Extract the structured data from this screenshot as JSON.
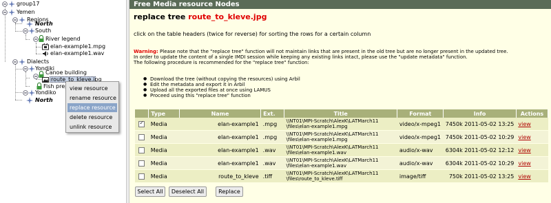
{
  "tree": {
    "root": "group17",
    "yemen": "Yemen",
    "regions": "Regions",
    "north": "North",
    "south": "South",
    "river_legend": "River legend",
    "elan_mpg": "elan-example1.mpg",
    "elan_wav": "elan-example1.wav",
    "dialects": "Dialects",
    "yondiki": "Yondiki",
    "canoe": "Canoe building",
    "route": "route_to_kleve.jpg",
    "fish": "Fish prep",
    "yondiko": "Yondiko",
    "north2": "North"
  },
  "context_menu": {
    "items": [
      "view resource",
      "rename resource",
      "replace resource",
      "delete resource",
      "unlink resource"
    ],
    "highlighted": "replace resource"
  },
  "panel": {
    "header": "Free Media resource Nodes",
    "title_prefix": "replace tree",
    "title_file": "route_to_kleve.jpg",
    "hint": "click on the table headers (twice for reverse) for sorting the rows for a certain column",
    "warning_label": "Warning:",
    "warning_text": " Please note that the \"replace tree\" function will not maintain links that are present in the old tree but are no longer present in the updated tree.",
    "warning_line2": "In order to update the content of a single IMDI session while keeping any existing links intact, please use the \"update metadata\" function.",
    "warning_line3": "The following procedure is recommended for the \"replace tree\" function:",
    "steps": [
      "Download the tree (without copying the resources) using Arbil",
      "Edit the metadata and export it in Arbil",
      "Upload all the exported files at once using LAMUS",
      "Proceed using this \"replace tree\" function"
    ]
  },
  "table": {
    "headers": [
      "",
      "Type",
      "Name",
      "Ext.",
      "Title",
      "Format",
      "Info",
      "Actions"
    ],
    "rows": [
      {
        "checked": true,
        "type": "Media",
        "name": "elan-example1",
        "ext": ".mpg",
        "title1": "\\\\NT01\\MPI-Scratch\\AlexK\\LATMarch11",
        "title2": "\\files\\elan-example1.mpg",
        "format": "video/x-mpeg1",
        "info": "7450k 2011-05-02 13:25",
        "action": "view"
      },
      {
        "checked": false,
        "type": "Media",
        "name": "elan-example1",
        "ext": ".mpg",
        "title1": "\\\\NT01\\MPI-Scratch\\AlexK\\LATMarch11",
        "title2": "\\files\\elan-example1.mpg",
        "format": "video/x-mpeg1",
        "info": "7450k 2011-05-02 10:29",
        "action": "view"
      },
      {
        "checked": false,
        "type": "Media",
        "name": "elan-example1",
        "ext": ".wav",
        "title1": "\\\\NT01\\MPI-Scratch\\AlexK\\LATMarch11",
        "title2": "\\files\\elan-example1.wav",
        "format": "audio/x-wav",
        "info": "6304k 2011-05-02 12:12",
        "action": "view"
      },
      {
        "checked": false,
        "type": "Media",
        "name": "elan-example1",
        "ext": ".wav",
        "title1": "\\\\NT01\\MPI-Scratch\\AlexK\\LATMarch11",
        "title2": "\\files\\elan-example1.wav",
        "format": "audio/x-wav",
        "info": "6304k 2011-05-02 10:29",
        "action": "view"
      },
      {
        "checked": false,
        "type": "Media",
        "name": "route_to_kleve",
        "ext": ".tiff",
        "title1": "\\\\NT01\\MPI-Scratch\\AlexK\\LATMarch11",
        "title2": "\\files\\route_to_kleve.tiff",
        "format": "image/tiff",
        "info": "750k 2011-05-02 13:25",
        "action": "view"
      }
    ]
  },
  "buttons": {
    "select_all": "Select All",
    "deselect_all": "Deselect All",
    "replace": "Replace"
  }
}
